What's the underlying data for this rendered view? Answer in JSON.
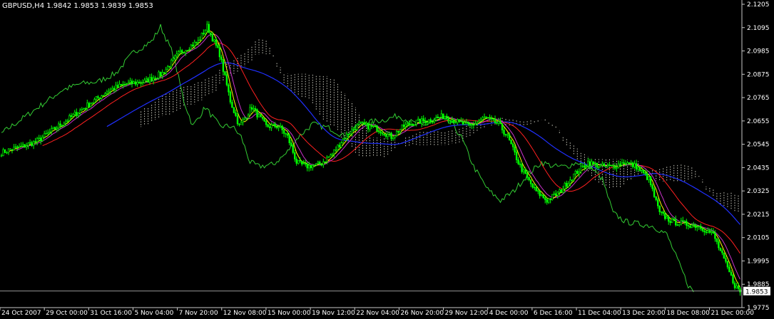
{
  "header": {
    "symbol_info": "GBPUSD,H4  1.9842 1.9853 1.9839 1.9853"
  },
  "colors": {
    "background": "#000000",
    "axis": "#c8c8c8",
    "text": "#ffffff",
    "candle": "#00ff00",
    "chikou": "#33cc33",
    "ma_fast": "#ffff00",
    "ma_purple": "#cc33cc",
    "ma_red": "#ff2020",
    "ma_blue": "#2030ff",
    "cloud": "#f0f0e0",
    "price_line": "#c8c8c8"
  },
  "chart_data": {
    "type": "candlestick",
    "instrument": "GBPUSD",
    "timeframe": "H4",
    "ylim": [
      1.9775,
      2.1205
    ],
    "y_ticks": [
      "2.1205",
      "2.1095",
      "2.0985",
      "2.0875",
      "2.0765",
      "2.0655",
      "2.0545",
      "2.0435",
      "2.0325",
      "2.0215",
      "2.0105",
      "1.9995",
      "1.9885",
      "1.9775"
    ],
    "x_ticks": [
      "24 Oct 2007",
      "29 Oct 00:00",
      "31 Oct 16:00",
      "5 Nov 04:00",
      "7 Nov 20:00",
      "12 Nov 08:00",
      "15 Nov 00:00",
      "19 Nov 12:00",
      "22 Nov 04:00",
      "26 Nov 20:00",
      "29 Nov 12:00",
      "4 Dec 00:00",
      "6 Dec 16:00",
      "11 Dec 04:00",
      "13 Dec 20:00",
      "18 Dec 08:00",
      "21 Dec 00:00"
    ],
    "current_price": "1.9853",
    "price_anchors": [
      [
        0,
        2.0505
      ],
      [
        5,
        2.052
      ],
      [
        10,
        2.053
      ],
      [
        20,
        2.056
      ],
      [
        30,
        2.062
      ],
      [
        40,
        2.068
      ],
      [
        50,
        2.074
      ],
      [
        60,
        2.08
      ],
      [
        70,
        2.083
      ],
      [
        80,
        2.084
      ],
      [
        90,
        2.088
      ],
      [
        100,
        2.098
      ],
      [
        110,
        2.103
      ],
      [
        115,
        2.11
      ],
      [
        122,
        2.097
      ],
      [
        128,
        2.075
      ],
      [
        133,
        2.063
      ],
      [
        140,
        2.072
      ],
      [
        148,
        2.063
      ],
      [
        155,
        2.063
      ],
      [
        160,
        2.058
      ],
      [
        165,
        2.046
      ],
      [
        170,
        2.044
      ],
      [
        178,
        2.045
      ],
      [
        185,
        2.05
      ],
      [
        192,
        2.058
      ],
      [
        200,
        2.064
      ],
      [
        210,
        2.062
      ],
      [
        218,
        2.058
      ],
      [
        225,
        2.063
      ],
      [
        232,
        2.065
      ],
      [
        240,
        2.066
      ],
      [
        248,
        2.068
      ],
      [
        255,
        2.065
      ],
      [
        262,
        2.063
      ],
      [
        270,
        2.067
      ],
      [
        278,
        2.064
      ],
      [
        283,
        2.058
      ],
      [
        290,
        2.044
      ],
      [
        298,
        2.033
      ],
      [
        305,
        2.028
      ],
      [
        312,
        2.032
      ],
      [
        320,
        2.04
      ],
      [
        328,
        2.046
      ],
      [
        335,
        2.044
      ],
      [
        342,
        2.044
      ],
      [
        348,
        2.046
      ],
      [
        355,
        2.044
      ],
      [
        362,
        2.038
      ],
      [
        368,
        2.022
      ],
      [
        375,
        2.018
      ],
      [
        382,
        2.017
      ],
      [
        390,
        2.016
      ],
      [
        398,
        2.012
      ],
      [
        405,
        1.998
      ],
      [
        410,
        1.988
      ],
      [
        413,
        1.985
      ]
    ],
    "series": [
      {
        "kind": "ma_fast",
        "period": 5
      },
      {
        "kind": "ma_purple",
        "period": 9
      },
      {
        "kind": "ma_red",
        "period": 24
      },
      {
        "kind": "ma_blue",
        "period": 60
      },
      {
        "kind": "chikou",
        "shift": 26
      },
      {
        "kind": "kumo",
        "tenkan": 9,
        "kijun": 26,
        "senkou": 52
      }
    ]
  }
}
